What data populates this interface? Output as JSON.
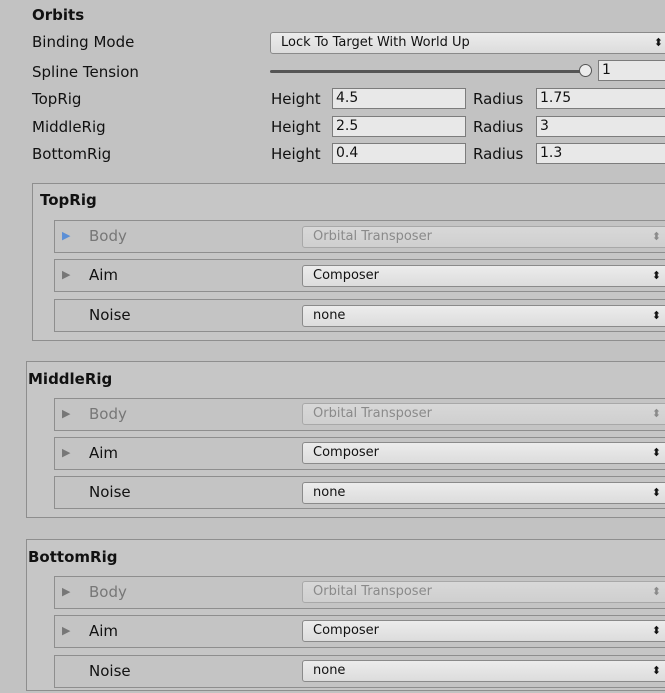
{
  "section_title": "Orbits",
  "binding_mode": {
    "label": "Binding Mode",
    "value": "Lock To Target With World Up"
  },
  "spline_tension": {
    "label": "Spline Tension",
    "value": "1",
    "level": 1
  },
  "rigs_params": {
    "height_label": "Height",
    "radius_label": "Radius",
    "top": {
      "label": "TopRig",
      "height": "4.5",
      "radius": "1.75"
    },
    "middle": {
      "label": "MiddleRig",
      "height": "2.5",
      "radius": "3"
    },
    "bottom": {
      "label": "BottomRig",
      "height": "0.4",
      "radius": "1.3"
    }
  },
  "dropdown_arrow": "⬍",
  "rig_panels": {
    "top": {
      "title": "TopRig",
      "body": {
        "label": "Body",
        "value": "Orbital Transposer"
      },
      "aim": {
        "label": "Aim",
        "value": "Composer"
      },
      "noise": {
        "label": "Noise",
        "value": "none"
      }
    },
    "middle": {
      "title": "MiddleRig",
      "body": {
        "label": "Body",
        "value": "Orbital Transposer"
      },
      "aim": {
        "label": "Aim",
        "value": "Composer"
      },
      "noise": {
        "label": "Noise",
        "value": "none"
      }
    },
    "bottom": {
      "title": "BottomRig",
      "body": {
        "label": "Body",
        "value": "Orbital Transposer"
      },
      "aim": {
        "label": "Aim",
        "value": "Composer"
      },
      "noise": {
        "label": "Noise",
        "value": "none"
      }
    }
  },
  "colors": {
    "background": "#c2c2c2",
    "expand_arrow_active": "#5b8fd6"
  }
}
